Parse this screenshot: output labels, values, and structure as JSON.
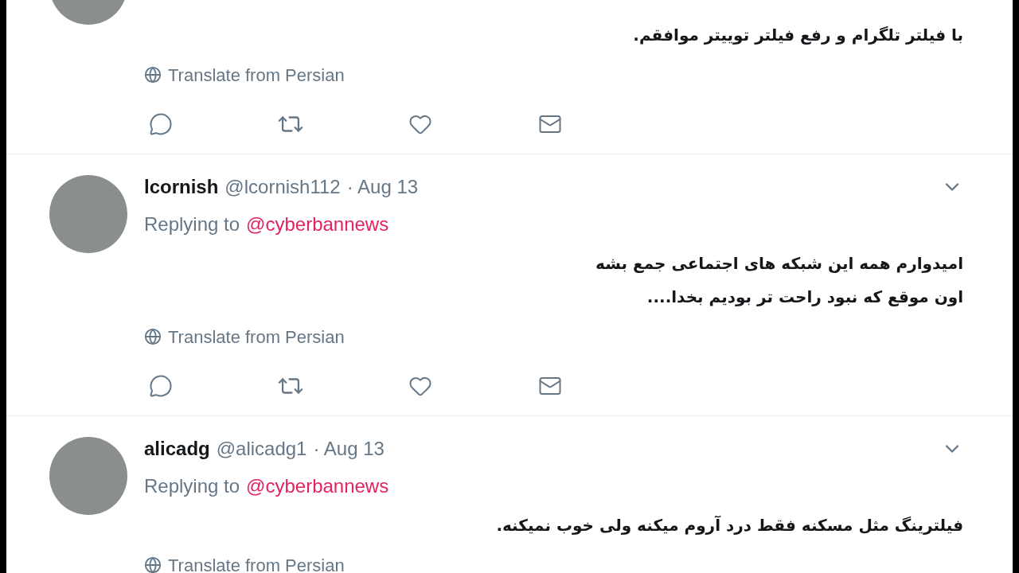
{
  "tweets": [
    {
      "text": [
        "با فیلتر تلگرام و رفع فیلتر توییتر موافقم."
      ],
      "translate": "Translate from Persian"
    },
    {
      "name": "lcornish",
      "handle": "@lcornish112",
      "date": "· Aug 13",
      "replying_label": "Replying to",
      "replying_to": "@cyberbannews",
      "text": [
        "امیدوارم همه این شبکه های اجتماعی جمع بشه",
        "اون موقع که نبود راحت تر بودیم بخدا...."
      ],
      "translate": "Translate from Persian"
    },
    {
      "name": "alicadg",
      "handle": "@alicadg1",
      "date": "· Aug 13",
      "replying_label": "Replying to",
      "replying_to": "@cyberbannews",
      "text": [
        "فیلترینگ مثل مسکنه فقط درد آروم میکنه ولی خوب نمیکنه."
      ],
      "translate": "Translate from Persian"
    }
  ]
}
